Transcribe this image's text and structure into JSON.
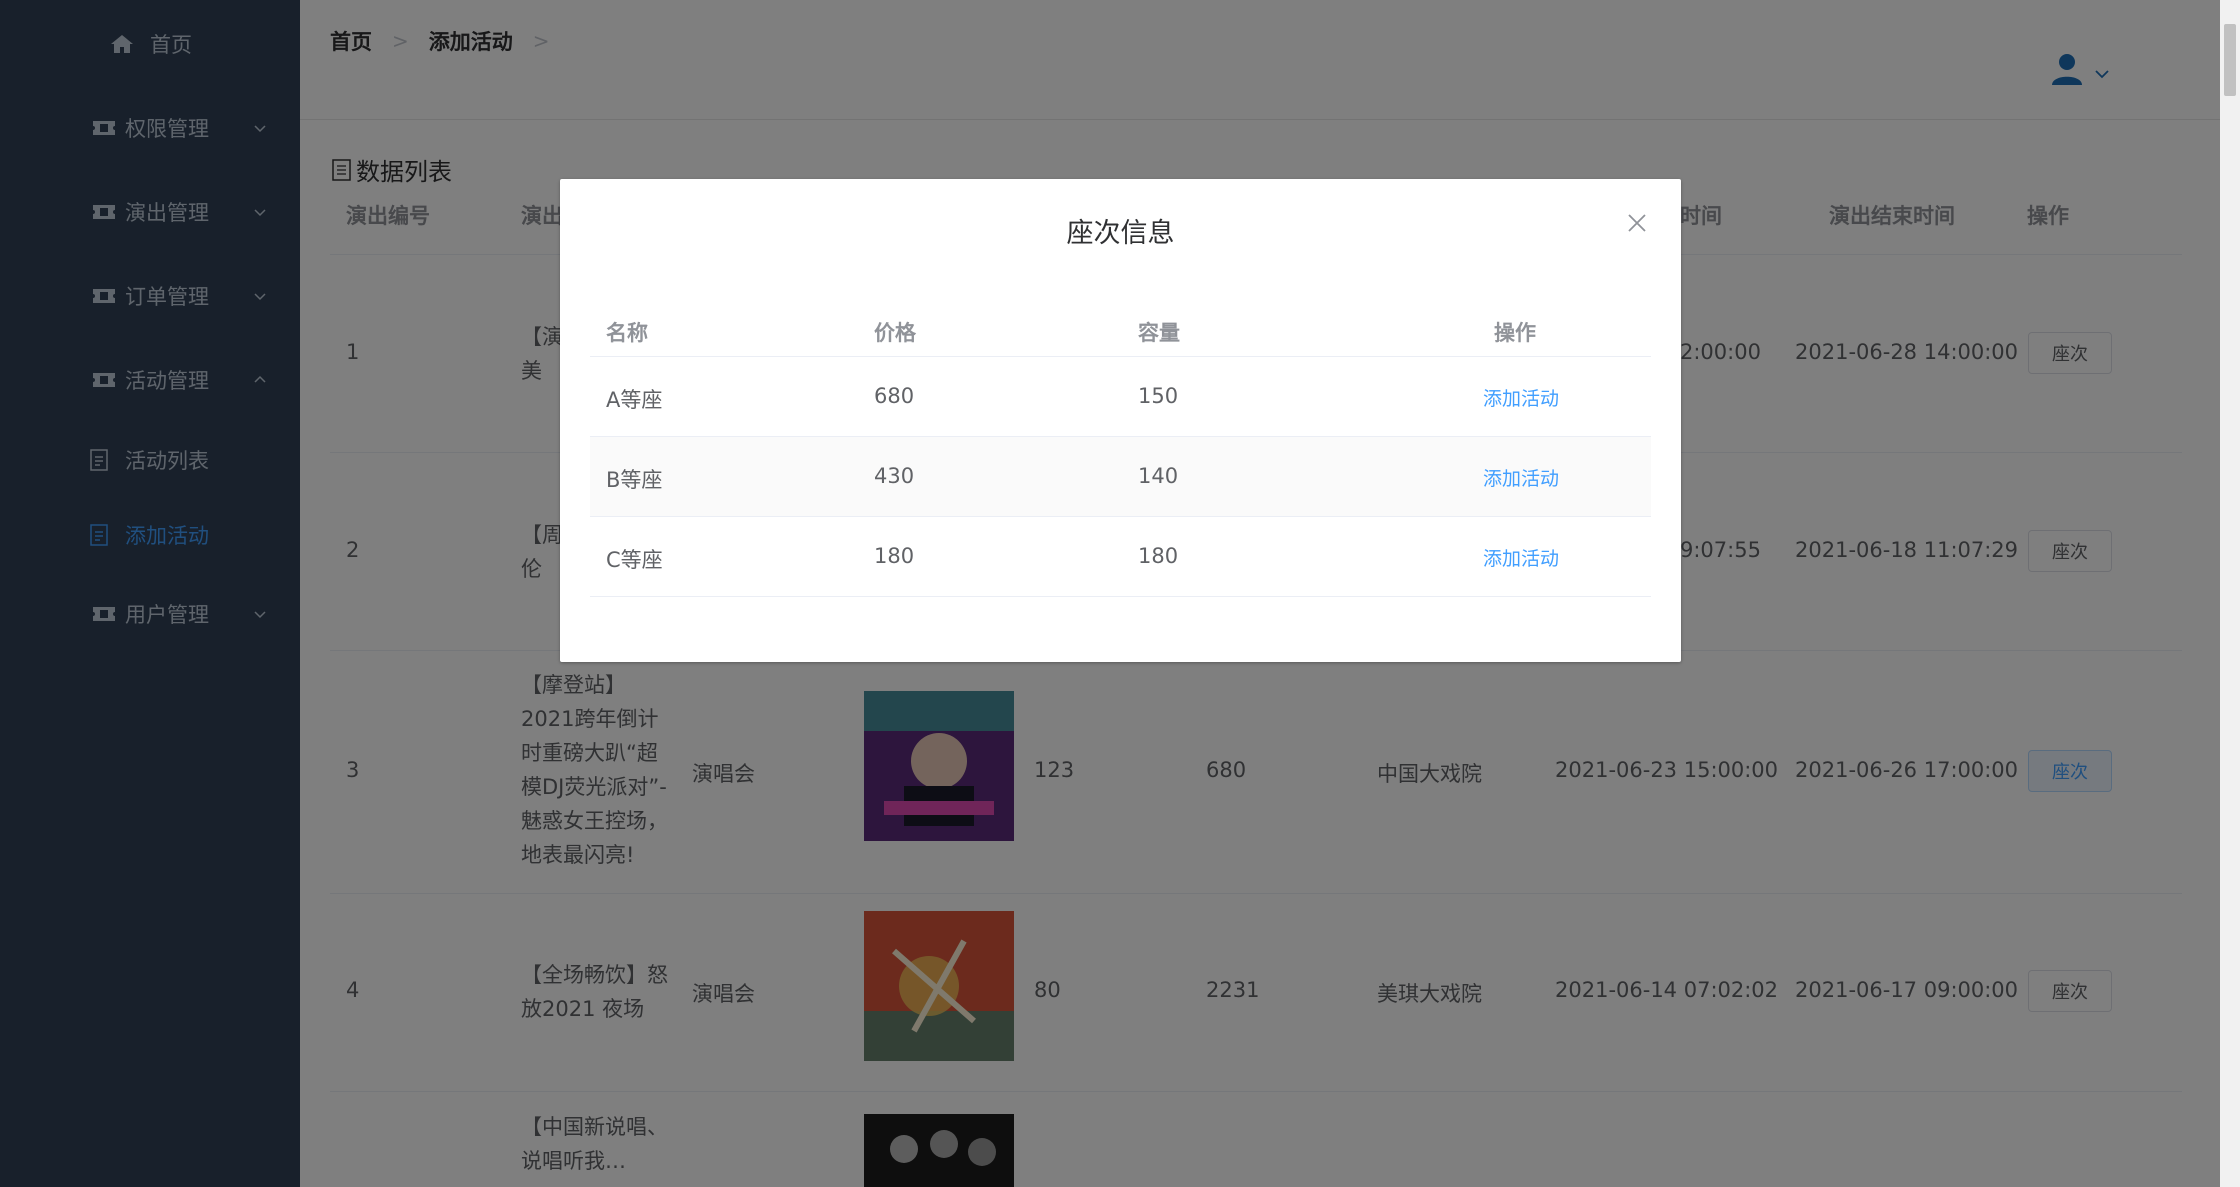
{
  "sidebar": {
    "home": "首页",
    "menus": [
      {
        "label": "权限管理",
        "expanded": false
      },
      {
        "label": "演出管理",
        "expanded": false
      },
      {
        "label": "订单管理",
        "expanded": false
      },
      {
        "label": "活动管理",
        "expanded": true
      },
      {
        "label": "用户管理",
        "expanded": false
      }
    ],
    "submenu": [
      {
        "label": "活动列表",
        "active": false
      },
      {
        "label": "添加活动",
        "active": true
      }
    ]
  },
  "breadcrumb": [
    "首页",
    "添加活动"
  ],
  "list_title": "数据列表",
  "table": {
    "headers": {
      "id": "演出编号",
      "name_partial": "演出",
      "start_partial": "时间",
      "end": "演出结束时间",
      "action": "操作"
    },
    "rows": [
      {
        "id": "1",
        "name": "【演…美的…",
        "start_partial": "2:00:00",
        "end": "2021-06-28 14:00:00",
        "action": "座次"
      },
      {
        "id": "2",
        "name": "【周…伦演…",
        "start_partial": "9:07:55",
        "end": "2021-06-18 11:07:29",
        "action": "座次"
      },
      {
        "id": "3",
        "name": "【摩登站】2021跨年倒计时重磅大趴“超模DJ荧光派对”-魅惑女王控场，地表最闪亮!",
        "type": "演唱会",
        "num1": "123",
        "num2": "680",
        "venue": "中国大戏院",
        "start": "2021-06-23 15:00:00",
        "end": "2021-06-26 17:00:00",
        "action": "座次"
      },
      {
        "id": "4",
        "name": "【全场畅饮】怒放2021 夜场",
        "type": "演唱会",
        "num1": "80",
        "num2": "2231",
        "venue": "美琪大戏院",
        "start": "2021-06-14 07:02:02",
        "end": "2021-06-17 09:00:00",
        "action": "座次"
      },
      {
        "id": "",
        "name": "【中国新说唱、说唱听我…"
      }
    ]
  },
  "dialog": {
    "title": "座次信息",
    "headers": {
      "name": "名称",
      "price": "价格",
      "capacity": "容量",
      "action": "操作"
    },
    "rows": [
      {
        "name": "A等座",
        "price": "680",
        "capacity": "150",
        "action": "添加活动"
      },
      {
        "name": "B等座",
        "price": "430",
        "capacity": "140",
        "action": "添加活动"
      },
      {
        "name": "C等座",
        "price": "180",
        "capacity": "180",
        "action": "添加活动"
      }
    ]
  },
  "colors": {
    "sidebar_bg": "#304156",
    "accent": "#409eff",
    "text": "#606266"
  }
}
